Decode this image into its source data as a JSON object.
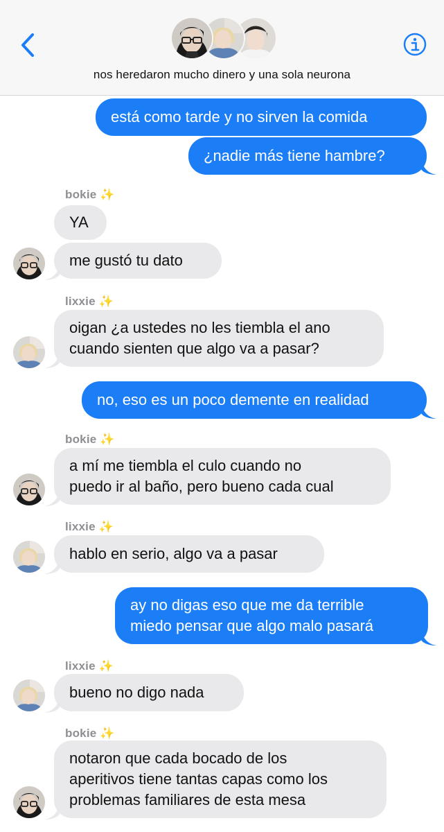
{
  "header": {
    "group_name": "nos heredaron mucho dinero y una sola neurona",
    "back_icon": "chevron-left-icon",
    "info_icon": "info-icon",
    "accent": "#1b7ef7"
  },
  "participants": [
    "bokie",
    "lixxie",
    "third-member"
  ],
  "messages": [
    {
      "dir": "out",
      "text": "está como tarde y no sirven la comida"
    },
    {
      "dir": "out",
      "text": "¿nadie más tiene hambre?"
    },
    {
      "dir": "in",
      "sender": "bokie ✨",
      "text": "YA"
    },
    {
      "dir": "in",
      "text": "me gustó tu dato"
    },
    {
      "dir": "in",
      "sender": "lixxie ✨",
      "text": "oigan ¿a ustedes no les tiembla el ano",
      "text2": "cuando sienten que algo va a pasar?"
    },
    {
      "dir": "out",
      "text": "no, eso es un poco demente en realidad"
    },
    {
      "dir": "in",
      "sender": "bokie ✨",
      "text": "a mí me tiembla el culo cuando no",
      "text2": "puedo ir al baño, pero bueno cada cual"
    },
    {
      "dir": "in",
      "sender": "lixxie ✨",
      "text": "hablo en serio, algo va a pasar"
    },
    {
      "dir": "out",
      "text": "ay no digas eso que me da terrible",
      "text2": "miedo pensar que algo malo pasará"
    },
    {
      "dir": "in",
      "sender": "lixxie ✨",
      "text": "bueno no digo nada"
    },
    {
      "dir": "in",
      "sender": "bokie ✨",
      "text": "notaron que cada bocado de los",
      "text2": "aperitivos tiene tantas capas como los",
      "text3": "problemas familiares de esta mesa"
    }
  ],
  "colors": {
    "outgoing_bubble": "#1b7ef7",
    "incoming_bubble": "#e9e9eb",
    "sender_label": "#8e8e93"
  }
}
